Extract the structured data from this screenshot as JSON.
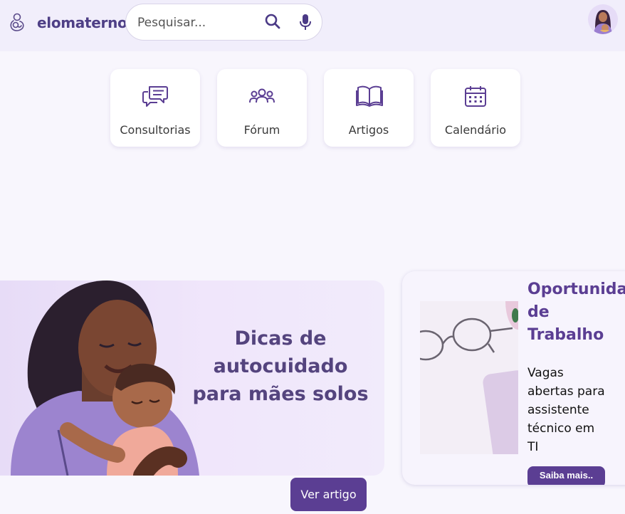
{
  "header": {
    "brand_name": "elomaterno",
    "brand_icon": "mother-child-icon",
    "search": {
      "placeholder": "Pesquisar...",
      "value": ""
    },
    "search_icon": "search-icon",
    "mic_icon": "microphone-icon",
    "avatar_icon": "user-avatar"
  },
  "nav_cards": [
    {
      "label": "Consultorias",
      "icon": "chat-bubbles-icon"
    },
    {
      "label": "Fórum",
      "icon": "group-icon"
    },
    {
      "label": "Artigos",
      "icon": "open-book-icon"
    },
    {
      "label": "Calendário",
      "icon": "calendar-icon"
    }
  ],
  "hero": {
    "title": "Dicas de autocuidado para mães solos",
    "button_label": "Ver artigo"
  },
  "job_card": {
    "title": "Oportunidade\nde\nTrabalho",
    "description": "Vagas abertas para assistente técnico em TI",
    "button_label": "Saiba mais.."
  },
  "colors": {
    "accent": "#5b3e93",
    "brand_text": "#4e3f86",
    "header_bg": "#f1eefb",
    "page_bg": "#f8f6fd",
    "hero_title": "#54447e"
  }
}
